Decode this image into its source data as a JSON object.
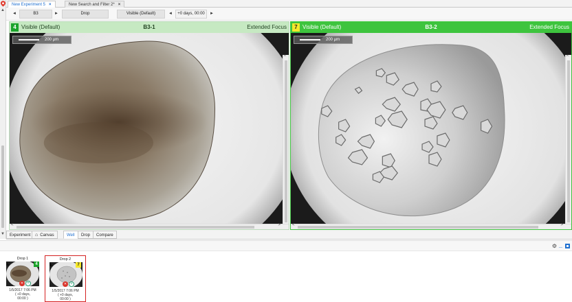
{
  "tabs": [
    {
      "label": "New Experiment 5",
      "close": "×",
      "active": true
    },
    {
      "label": "New Search and Filter 2*",
      "close": "×",
      "active": false
    }
  ],
  "toolbar": {
    "prev_arrow": "◄",
    "well": "B3",
    "next_arrow": "►",
    "drop": "Drop",
    "imaging": "Visible (Default)",
    "time_prev": "◄",
    "time": "+0 days, 00:00",
    "time_next": "►"
  },
  "panes": [
    {
      "score": "4",
      "score_color": "#1aa32a",
      "header_bg": "#c6e9c2",
      "header_text_color": "#1f3f1f",
      "imaging": "Visible (Default)",
      "well": "B3-1",
      "focus": "Extended Focus",
      "scale_label": "200 µm"
    },
    {
      "score": "7",
      "score_color": "#f5e82a",
      "header_bg": "#3ec43e",
      "header_text_color": "#ffffff",
      "imaging": "Visible (Default)",
      "well": "B3-2",
      "focus": "Extended Focus",
      "scale_label": "200 µm"
    }
  ],
  "view_tabs": [
    {
      "label": "Experiment",
      "icon": "",
      "active": false
    },
    {
      "label": "Canvas",
      "icon": "camera-icon",
      "active": false
    },
    {
      "label": "Well",
      "icon": "",
      "active": true
    },
    {
      "label": "Drop",
      "icon": "",
      "active": false
    },
    {
      "label": "Compare",
      "icon": "",
      "active": false
    }
  ],
  "lower_panel": {
    "gear": "⚙",
    "minimize": "_"
  },
  "drops": [
    {
      "label": "Drop 1",
      "score": "4",
      "score_color": "#1aa32a",
      "date": "1/5/2017 7:06 PM",
      "elapsed": "( +0 days,",
      "clock": "00:00 )",
      "selected": false
    },
    {
      "label": "Drop 2",
      "score": "7",
      "score_color": "#f5e82a",
      "date": "1/5/2017 7:06 PM",
      "elapsed": "( +0 days,",
      "clock": "00:00 )",
      "selected": true
    }
  ],
  "colors": {
    "accent": "#1e6fd0",
    "selected_border": "#d42020"
  }
}
